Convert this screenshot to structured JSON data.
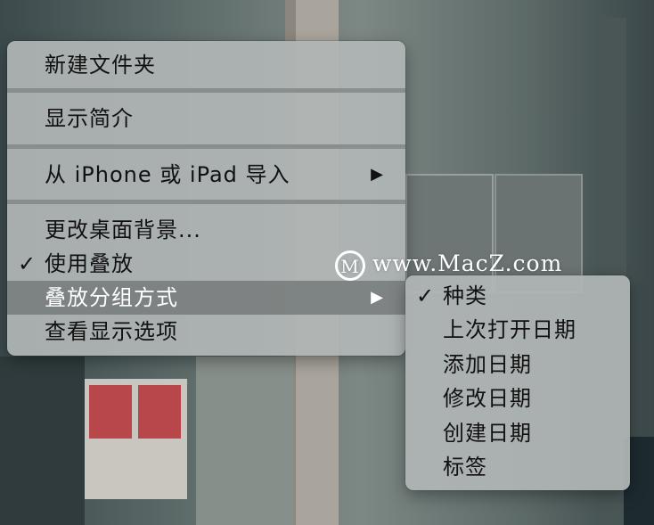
{
  "main_menu": {
    "items": [
      {
        "label": "新建文件夹"
      },
      {
        "label": "显示简介"
      },
      {
        "label": "从 iPhone 或 iPad 导入",
        "submenu_arrow": "▶"
      },
      {
        "label": "更改桌面背景..."
      },
      {
        "label": "使用叠放",
        "checked": true,
        "check": "✓"
      },
      {
        "label": "叠放分组方式",
        "submenu_arrow": "▶",
        "highlighted": true
      },
      {
        "label": "查看显示选项"
      }
    ]
  },
  "sub_menu": {
    "items": [
      {
        "label": "种类",
        "checked": true,
        "check": "✓"
      },
      {
        "label": "上次打开日期"
      },
      {
        "label": "添加日期"
      },
      {
        "label": "修改日期"
      },
      {
        "label": "创建日期"
      },
      {
        "label": "标签"
      }
    ]
  },
  "watermark": {
    "logo_letter": "M",
    "text": "www.MacZ.com"
  },
  "colors": {
    "menu_bg": "#b0b6b6",
    "highlight": "#767a7a",
    "text": "#111111",
    "highlight_text": "#ffffff"
  }
}
